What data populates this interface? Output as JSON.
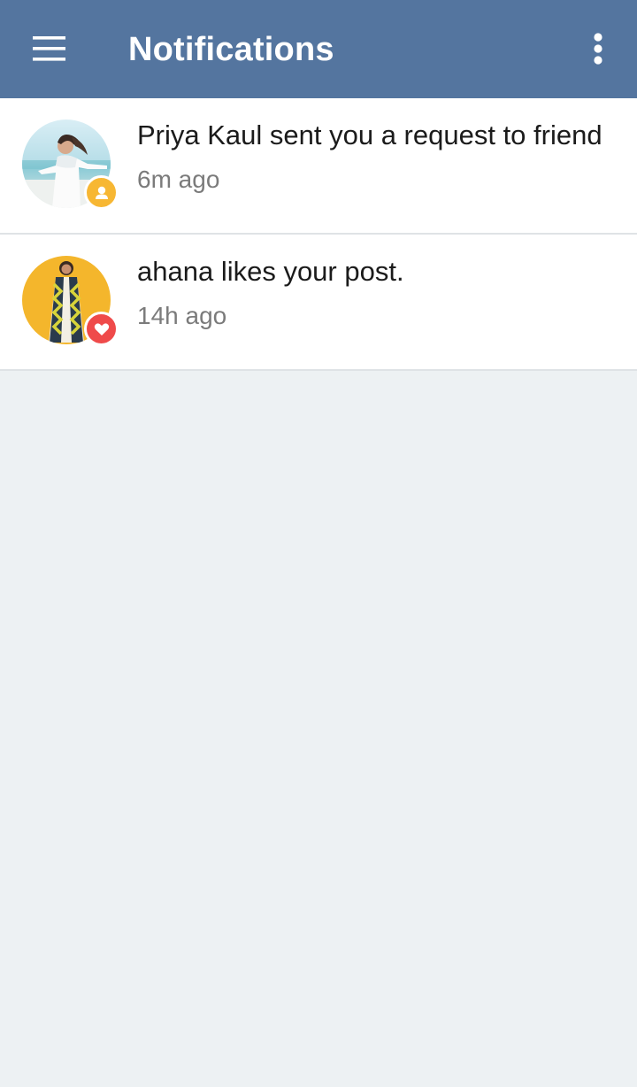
{
  "toolbar": {
    "title": "Notifications",
    "menu_icon": "hamburger-menu-icon",
    "overflow_icon": "more-vert-icon",
    "background_color": "#54759f"
  },
  "notifications": [
    {
      "message": "Priya Kaul sent you a request to friend",
      "time": "6m ago",
      "badge_icon": "friend-request-icon",
      "badge_color": "#f7b733"
    },
    {
      "message": "ahana likes your post.",
      "time": "14h ago",
      "badge_icon": "heart-icon",
      "badge_color": "#ef4a4a"
    }
  ]
}
